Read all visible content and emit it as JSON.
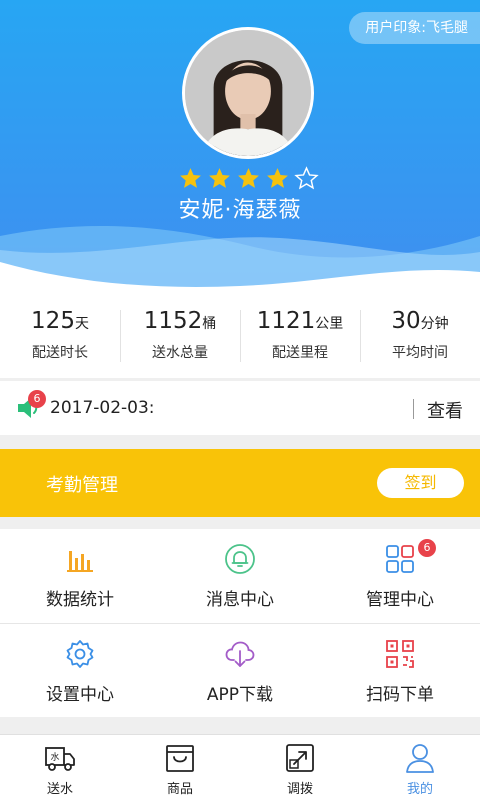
{
  "header": {
    "impression_label": "用户印象:飞毛腿",
    "user_name": "安妮·海瑟薇",
    "rating": 4,
    "rating_max": 5,
    "star_color": "#f5c20f"
  },
  "stats": [
    {
      "value": "125",
      "unit": "天",
      "label": "配送时长"
    },
    {
      "value": "1152",
      "unit": "桶",
      "label": "送水总量"
    },
    {
      "value": "1121",
      "unit": "公里",
      "label": "配送里程"
    },
    {
      "value": "30",
      "unit": "分钟",
      "label": "平均时间"
    }
  ],
  "notice": {
    "icon": "speaker-icon",
    "badge": "6",
    "date": "2017-02-03:",
    "view_label": "查看"
  },
  "attendance": {
    "title": "考勤管理",
    "button_label": "签到",
    "color": "#f9c308"
  },
  "grid": [
    {
      "label": "数据统计",
      "icon": "bar-chart-icon",
      "color": "#f5a623"
    },
    {
      "label": "消息中心",
      "icon": "bell-icon",
      "color": "#4cc38a"
    },
    {
      "label": "管理中心",
      "icon": "grid-icon",
      "color": "#3b8fe6",
      "badge": "6"
    },
    {
      "label": "设置中心",
      "icon": "gear-icon",
      "color": "#3b8fe6"
    },
    {
      "label": "APP下载",
      "icon": "cloud-download-icon",
      "color": "#a35cc8"
    },
    {
      "label": "扫码下单",
      "icon": "qr-code-icon",
      "color": "#e8424a"
    }
  ],
  "tabbar": [
    {
      "label": "送水",
      "icon": "truck-icon"
    },
    {
      "label": "商品",
      "icon": "bag-icon"
    },
    {
      "label": "调拨",
      "icon": "transfer-icon"
    },
    {
      "label": "我的",
      "icon": "person-icon",
      "active": true
    }
  ],
  "badge_color": "#e8424a",
  "accent_color": "#4a90e2"
}
